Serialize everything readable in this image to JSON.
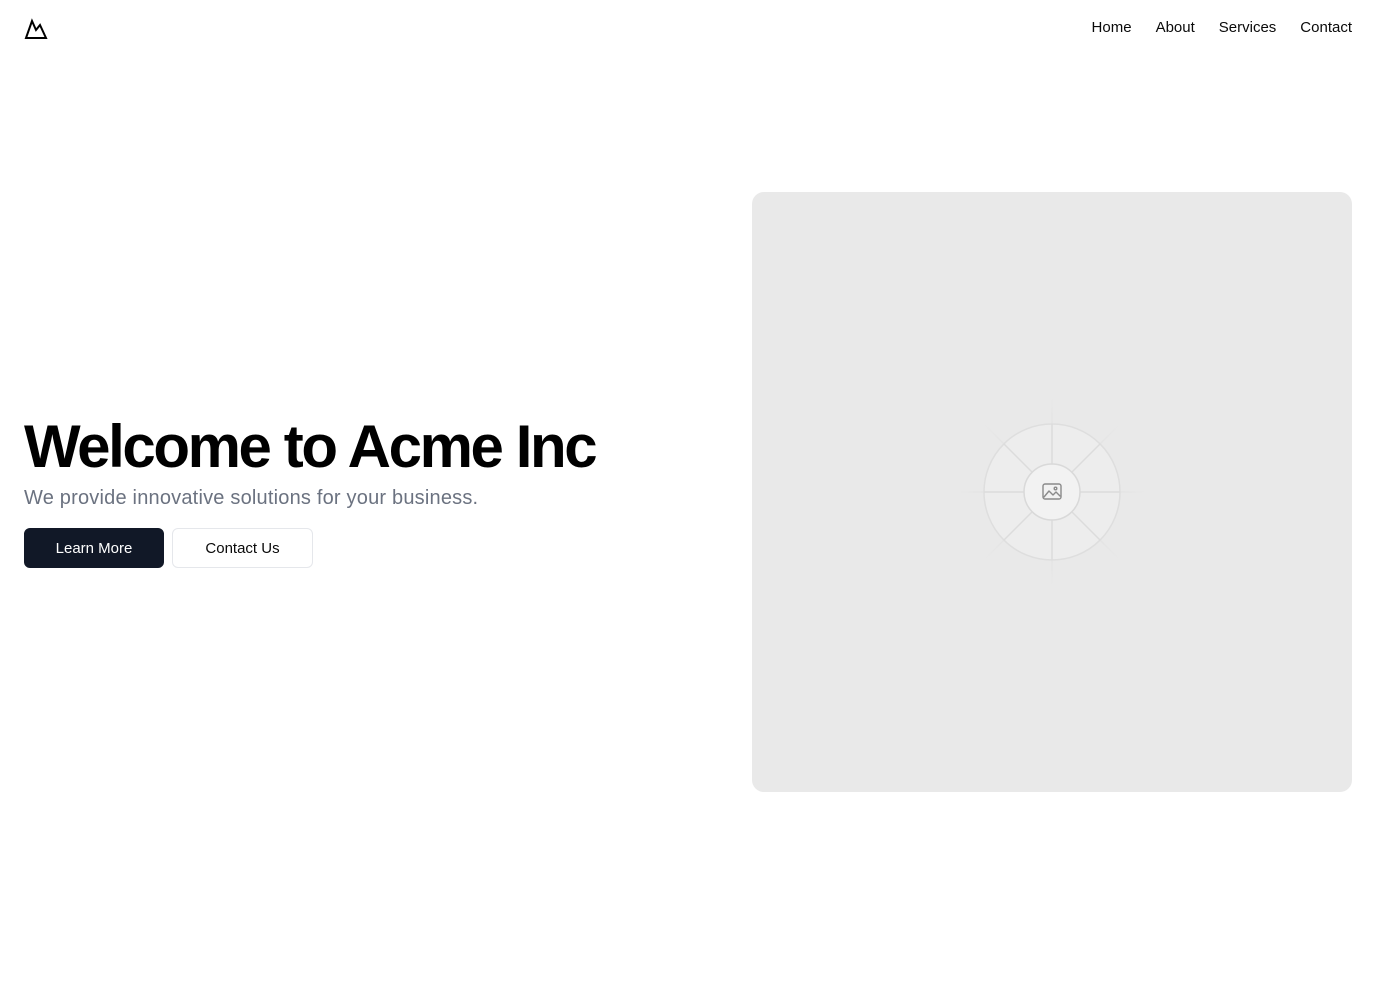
{
  "header": {
    "logo_icon": "mountain-icon",
    "nav": [
      {
        "label": "Home"
      },
      {
        "label": "About"
      },
      {
        "label": "Services"
      },
      {
        "label": "Contact"
      }
    ]
  },
  "hero": {
    "title": "Welcome to Acme Inc",
    "subtitle": "We provide innovative solutions for your business.",
    "primary_button": "Learn More",
    "secondary_button": "Contact Us",
    "image_icon": "image-placeholder-icon"
  },
  "colors": {
    "primary_button_bg": "#111827",
    "subtitle_text": "#6b7280",
    "image_bg": "#e9e9e9"
  }
}
